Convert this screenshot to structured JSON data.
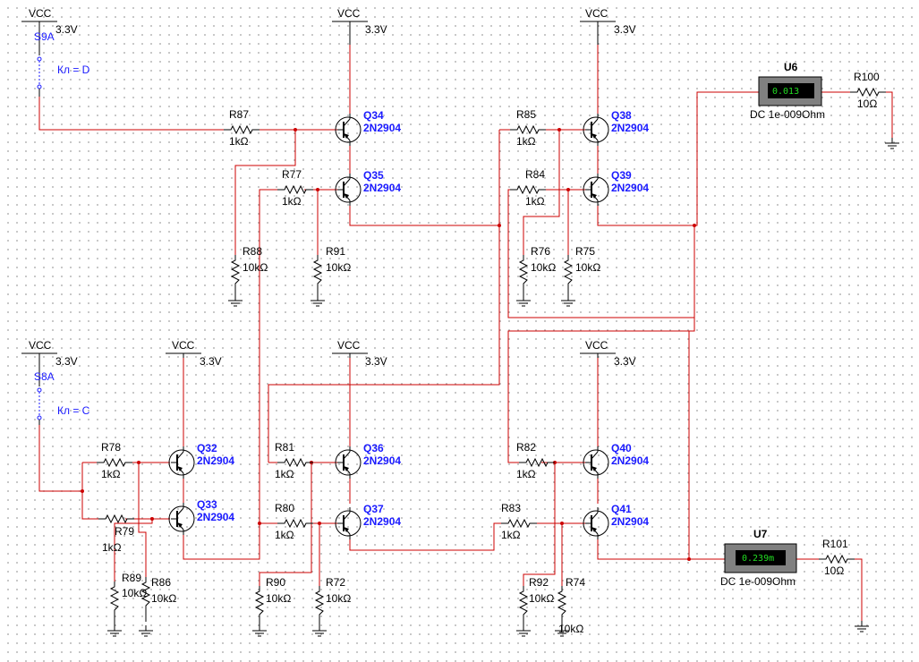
{
  "supplies": [
    {
      "id": "vcc1",
      "name": "VCC",
      "value": "3.3V"
    },
    {
      "id": "vcc2",
      "name": "VCC",
      "value": "3.3V"
    },
    {
      "id": "vcc3",
      "name": "VCC",
      "value": "3.3V"
    },
    {
      "id": "vcc4",
      "name": "VCC",
      "value": "3.3V"
    },
    {
      "id": "vcc5",
      "name": "VCC",
      "value": "3.3V"
    },
    {
      "id": "vcc6",
      "name": "VCC",
      "value": "3.3V"
    },
    {
      "id": "vcc7",
      "name": "VCC",
      "value": "3.3V"
    }
  ],
  "switches": [
    {
      "ref": "S9A",
      "key": "Кл = D"
    },
    {
      "ref": "S8A",
      "key": "Кл = C"
    }
  ],
  "transistors": [
    {
      "ref": "Q34",
      "model": "2N2904"
    },
    {
      "ref": "Q35",
      "model": "2N2904"
    },
    {
      "ref": "Q38",
      "model": "2N2904"
    },
    {
      "ref": "Q39",
      "model": "2N2904"
    },
    {
      "ref": "Q32",
      "model": "2N2904"
    },
    {
      "ref": "Q33",
      "model": "2N2904"
    },
    {
      "ref": "Q36",
      "model": "2N2904"
    },
    {
      "ref": "Q37",
      "model": "2N2904"
    },
    {
      "ref": "Q40",
      "model": "2N2904"
    },
    {
      "ref": "Q41",
      "model": "2N2904"
    }
  ],
  "resistors": [
    {
      "ref": "R87",
      "value": "1kΩ"
    },
    {
      "ref": "R77",
      "value": "1kΩ"
    },
    {
      "ref": "R88",
      "value": "10kΩ"
    },
    {
      "ref": "R91",
      "value": "10kΩ"
    },
    {
      "ref": "R85",
      "value": "1kΩ"
    },
    {
      "ref": "R84",
      "value": "1kΩ"
    },
    {
      "ref": "R76",
      "value": "10kΩ"
    },
    {
      "ref": "R75",
      "value": "10kΩ"
    },
    {
      "ref": "R100",
      "value": "10Ω"
    },
    {
      "ref": "R78",
      "value": "1kΩ"
    },
    {
      "ref": "R79",
      "value": "1kΩ"
    },
    {
      "ref": "R89",
      "value": "10kΩ"
    },
    {
      "ref": "R86",
      "value": "10kΩ"
    },
    {
      "ref": "R81",
      "value": "1kΩ"
    },
    {
      "ref": "R80",
      "value": "1kΩ"
    },
    {
      "ref": "R90",
      "value": "10kΩ"
    },
    {
      "ref": "R72",
      "value": "10kΩ"
    },
    {
      "ref": "R82",
      "value": "1kΩ"
    },
    {
      "ref": "R83",
      "value": "1kΩ"
    },
    {
      "ref": "R92",
      "value": "10kΩ"
    },
    {
      "ref": "R74",
      "value": "10kΩ"
    },
    {
      "ref": "R101",
      "value": "10Ω"
    }
  ],
  "meters": [
    {
      "ref": "U6",
      "reading": "0.013",
      "mode": "DC  1e-009Ohm"
    },
    {
      "ref": "U7",
      "reading": "0.239m",
      "mode": "DC  1e-009Ohm"
    }
  ],
  "colors": {
    "wire": "#cc0000",
    "component": "#000000",
    "label": "#1a1aff",
    "meter_body": "#808080",
    "meter_screen": "#000000",
    "meter_text": "#22dd22"
  }
}
